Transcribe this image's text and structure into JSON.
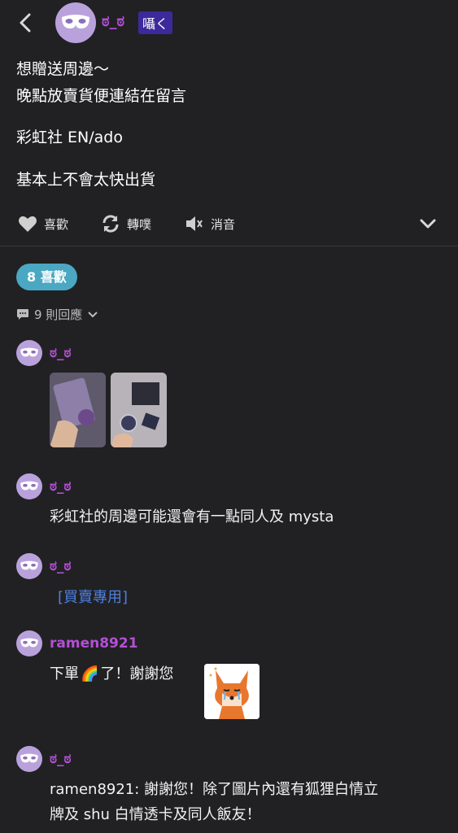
{
  "post": {
    "author": "ಠ_ಠ",
    "author_tag": "囁く",
    "lines": [
      "想贈送周邊～",
      "晚點放賣貨便連結在留言",
      "彩虹社 EN/ado",
      "基本上不會太快出貨"
    ]
  },
  "actions": {
    "like": "喜歡",
    "repost": "轉噗",
    "mute": "消音"
  },
  "likes_badge": "8 喜歡",
  "replies_toggle": "9 則回應",
  "comments": [
    {
      "author": "ಠ_ಠ",
      "type": "images"
    },
    {
      "author": "ಠ_ಠ",
      "text": "彩虹社的周邊可能還會有一點同人及 mysta"
    },
    {
      "author": "ಠ_ಠ",
      "link": "[買賣專用]"
    },
    {
      "author": "ramen8921",
      "text_before": "下單",
      "emoji": "🌈",
      "text_after": "了！謝謝您"
    },
    {
      "author": "ಠ_ಠ",
      "text_line1": "ramen8921: 謝謝您！除了圖片內還有狐狸白情立",
      "text_line2": "牌及 shu 白情透卡及同人飯友！"
    }
  ],
  "colors": {
    "background": "#212123",
    "accent_name": "#b44fd7",
    "badge": "#4aa8c2",
    "link": "#4f7fe0",
    "avatar": "#b9a2dc"
  }
}
